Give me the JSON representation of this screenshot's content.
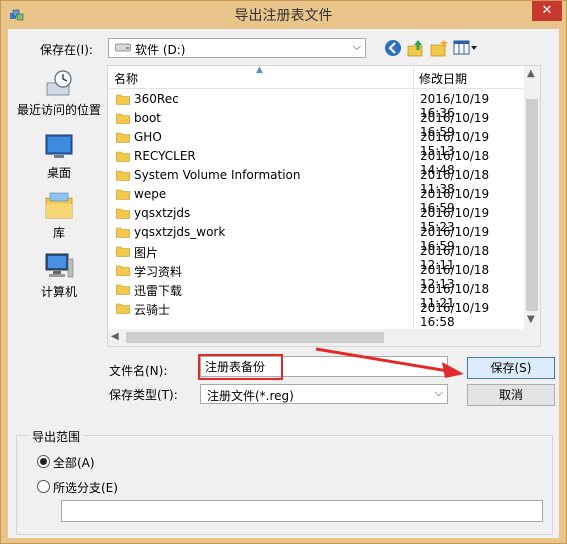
{
  "window": {
    "title": "导出注册表文件",
    "close_label": "✕"
  },
  "toolbar": {
    "save_in_label": "保存在(I):",
    "save_in_value": "软件 (D:)"
  },
  "places": [
    {
      "label": "最近访问的位置",
      "icon": "recent-places-icon"
    },
    {
      "label": "桌面",
      "icon": "desktop-icon"
    },
    {
      "label": "库",
      "icon": "libraries-icon"
    },
    {
      "label": "计算机",
      "icon": "computer-icon"
    }
  ],
  "list": {
    "col_name": "名称",
    "col_date": "修改日期",
    "rows": [
      {
        "name": "360Rec",
        "date": "2016/10/19 16:36"
      },
      {
        "name": "boot",
        "date": "2016/10/19 16:59"
      },
      {
        "name": "GHO",
        "date": "2016/10/19 15:13"
      },
      {
        "name": "RECYCLER",
        "date": "2016/10/18 14:48"
      },
      {
        "name": "System Volume Information",
        "date": "2016/10/18 11:38"
      },
      {
        "name": "wepe",
        "date": "2016/10/19 16:59"
      },
      {
        "name": "yqsxtzjds",
        "date": "2016/10/19 15:23"
      },
      {
        "name": "yqsxtzjds_work",
        "date": "2016/10/19 16:59"
      },
      {
        "name": "图片",
        "date": "2016/10/18 12:11"
      },
      {
        "name": "学习资料",
        "date": "2016/10/18 12:13"
      },
      {
        "name": "迅雷下载",
        "date": "2016/10/18 11:21"
      },
      {
        "name": "云骑士",
        "date": "2016/10/19 16:58"
      }
    ]
  },
  "form": {
    "filename_label": "文件名(N):",
    "filename_value": "注册表备份",
    "filetype_label": "保存类型(T):",
    "filetype_value": "注册文件(*.reg)",
    "save_button": "保存(S)",
    "cancel_button": "取消"
  },
  "export_range": {
    "title": "导出范围",
    "all_label": "全部(A)",
    "branch_label": "所选分支(E)",
    "branch_value": "",
    "selected": "all"
  },
  "colors": {
    "frame": "#e9c58c",
    "close": "#c7382e",
    "highlight": "#e32a2a"
  }
}
